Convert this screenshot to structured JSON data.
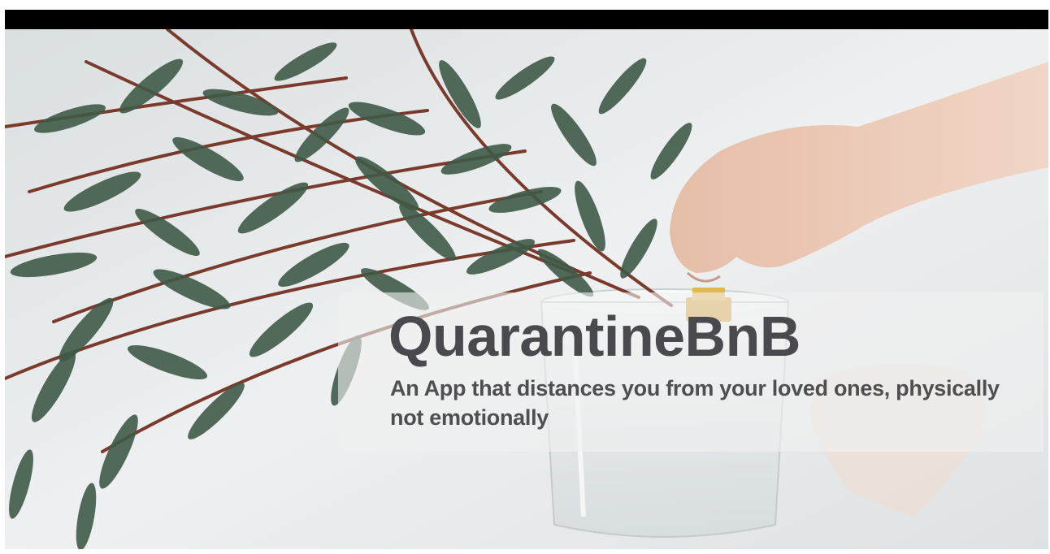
{
  "hero": {
    "title": "QuarantineBnB",
    "tagline": "An App that distances you from your loved ones, physically not emotionally"
  },
  "colors": {
    "title_text": "#4a4a4e",
    "tagline_text": "#4f4f52",
    "caption_panel": "#f0f0f0",
    "letterbox": "#000000",
    "leaf_green": "#3f5a48",
    "stem_red": "#7a3a2c",
    "skin": "#e8c4b0",
    "clip_gold": "#d4a33a"
  },
  "icons": [
    "eucalyptus-illustration",
    "hand-illustration",
    "glass-vase-illustration",
    "gold-clip-illustration"
  ]
}
